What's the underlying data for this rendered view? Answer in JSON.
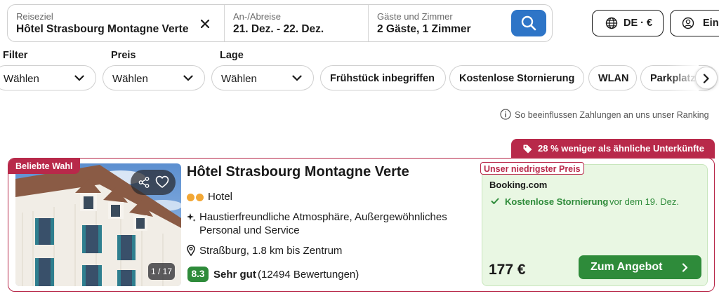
{
  "search": {
    "destination": {
      "label": "Reiseziel",
      "value": "Hôtel Strasbourg Montagne Verte"
    },
    "dates": {
      "label": "An-/Abreise",
      "value": "21. Dez. - 22. Dez."
    },
    "guests": {
      "label": "Gäste und Zimmer",
      "value": "2 Gäste, 1 Zimmer"
    },
    "clear_icon": "close-icon",
    "search_icon": "search-icon"
  },
  "header": {
    "language_currency": "DE · €",
    "login_label": "Einl"
  },
  "filters": {
    "groups": [
      {
        "label": "Filter",
        "value": "Wählen"
      },
      {
        "label": "Preis",
        "value": "Wählen"
      },
      {
        "label": "Lage",
        "value": "Wählen"
      }
    ],
    "chips": [
      "Frühstück inbegriffen",
      "Kostenlose Stornierung",
      "WLAN",
      "Parkplatz"
    ]
  },
  "ranking_info": "So beeinflussen Zahlungen an uns unser Ranking",
  "deal_banner": "28 % weniger als ähnliche Unterkünfte",
  "hotel": {
    "badge": "Beliebte Wahl",
    "photo_counter": "1 / 17",
    "name": "Hôtel Strasbourg Montagne Verte",
    "star_rating": 2,
    "type": "Hotel",
    "highlights": "Haustierfreundliche Atmosphäre, Außergewöhnliches Personal und Service",
    "location": "Straßburg, 1.8 km bis Zentrum",
    "score": "8.3",
    "score_label": "Sehr gut",
    "reviews": "(12494 Bewertungen)"
  },
  "offer": {
    "badge": "Unser niedrigster Preis",
    "provider": "Booking.com",
    "cancellation_bold": "Kostenlose Stornierung",
    "cancellation_rest": "vor dem 19. Dez.",
    "price": "177 €",
    "cta": "Zum Angebot"
  },
  "colors": {
    "accent_blue": "#2e75c7",
    "deal_red": "#b8294a",
    "offer_green": "#2e8b3a",
    "offer_bg": "#e9f7e3",
    "rating_dots": "#f2a735"
  }
}
